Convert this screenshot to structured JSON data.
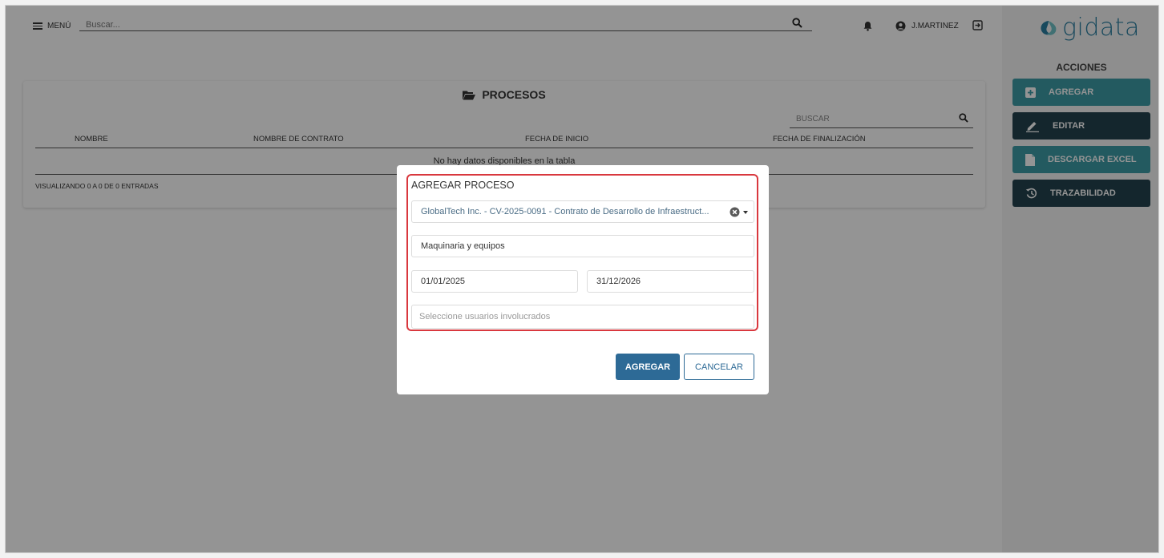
{
  "topbar": {
    "menu_label": "MENÚ",
    "search_placeholder": "Buscar...",
    "username": "J.MARTINEZ",
    "logo_text": "gidata"
  },
  "sidebar": {
    "title": "ACCIONES",
    "actions": [
      {
        "label": "AGREGAR",
        "icon": "plus-square-icon",
        "color": "#3d9ba6"
      },
      {
        "label": "EDITAR",
        "icon": "pencil-icon",
        "color": "#23424e"
      },
      {
        "label": "DESCARGAR EXCEL",
        "icon": "file-icon",
        "color": "#3d9ba6"
      },
      {
        "label": "TRAZABILIDAD",
        "icon": "history-icon",
        "color": "#23424e"
      }
    ]
  },
  "card": {
    "title": "PROCESOS",
    "search_placeholder": "BUSCAR",
    "columns": [
      "NOMBRE",
      "NOMBRE DE CONTRATO",
      "FECHA DE INICIO",
      "FECHA DE FINALIZACIÓN"
    ],
    "empty_message": "No hay datos disponibles en la tabla",
    "entries_info": "VISUALIZANDO 0 A 0 DE 0 ENTRADAS"
  },
  "modal": {
    "title": "AGREGAR PROCESO",
    "contract_select": "GlobalTech Inc. - CV-2025-0091 - Contrato de Desarrollo de Infraestruct...",
    "name_value": "Maquinaria y equipos",
    "start_date": "01/01/2025",
    "end_date": "31/12/2026",
    "users_placeholder": "Seleccione usuarios involucrados",
    "submit_label": "AGREGAR",
    "cancel_label": "CANCELAR"
  },
  "colors": {
    "accent_teal": "#3d9ba6",
    "accent_dark": "#23424e",
    "primary_blue": "#2d6a96",
    "highlight_red": "#d9383e"
  }
}
